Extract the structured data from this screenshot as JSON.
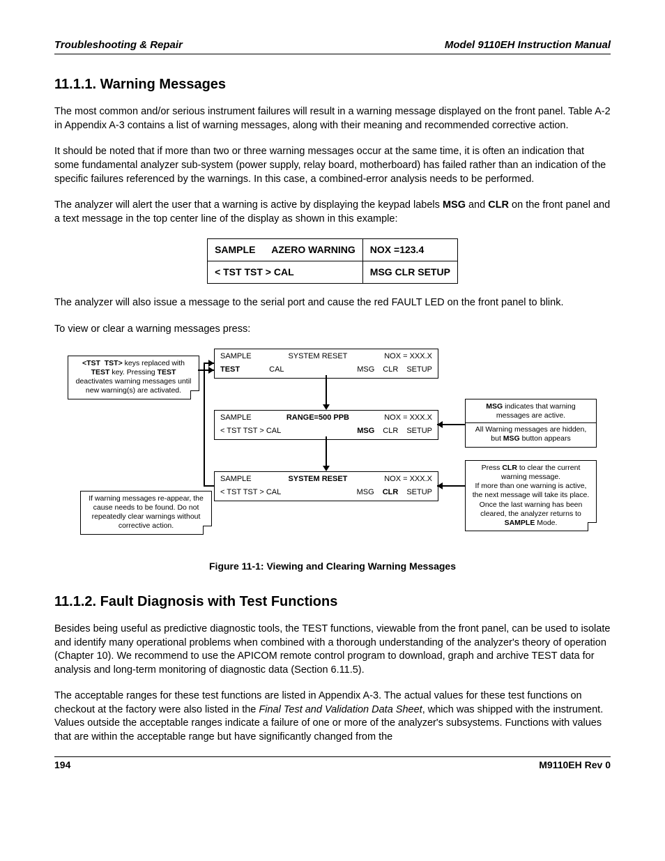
{
  "header": {
    "left": "Troubleshooting & Repair",
    "right": "Model 9110EH Instruction Manual"
  },
  "sec1": {
    "title": "11.1.1. Warning Messages",
    "p1": "The most common and/or serious instrument failures will result in a warning message displayed on the front panel. Table A-2 in Appendix A-3 contains a list of warning messages, along with their meaning and recommended corrective action.",
    "p2": "It should be noted that if more than two or three warning messages occur at the same time, it is often an indication that some fundamental analyzer sub-system (power supply, relay board, motherboard) has failed rather than an indication of the specific failures referenced by the warnings. In this case, a combined-error analysis needs to be performed.",
    "p3a": "The analyzer will alert the user that a warning is active by displaying the keypad labels ",
    "p3b": " and ",
    "p3c": " on the front panel and a text message in the top center line of the display as shown in this example:",
    "msg": "MSG",
    "clr": "CLR",
    "display": {
      "r1c1": "SAMPLE",
      "r1c2": "AZERO WARNING",
      "r1c3": "NOX =123.4",
      "r2c1": "< TST  TST >  CAL",
      "r2c2": "MSG  CLR   SETUP"
    },
    "p4": "The analyzer will also issue a message to the serial port and cause the red FAULT LED on the front panel to blink.",
    "p5": "To view or clear a warning messages press:"
  },
  "flow": {
    "note_left_top": "<TST  TST> keys replaced with TEST key. Pressing TEST deactivates warning messages until new warning(s) are activated.",
    "note_left_bot": "If warning messages re-appear, the cause needs to be found. Do not repeatedly clear warnings without corrective action.",
    "note_right_top": "MSG indicates that warning messages are active.\nAll Warning messages are hidden, but MSG button appears",
    "note_right_bot": "Press CLR to clear the current warning message.\nIf more than one warning is active, the next message will take its place.\nOnce the last warning has been cleared, the analyzer returns to SAMPLE Mode.",
    "p1": {
      "a": "SAMPLE",
      "b": "SYSTEM RESET",
      "c": "NOX = XXX.X",
      "d": "TEST",
      "e": "CAL",
      "f": "MSG",
      "g": "CLR",
      "h": "SETUP"
    },
    "p2": {
      "a": "SAMPLE",
      "b": "RANGE=500 PPB",
      "c": "NOX = XXX.X",
      "d": "< TST  TST >  CAL",
      "f": "MSG",
      "g": "CLR",
      "h": "SETUP"
    },
    "p3": {
      "a": "SAMPLE",
      "b": "SYSTEM RESET",
      "c": "NOX = XXX.X",
      "d": "< TST  TST >  CAL",
      "f": "MSG",
      "g": "CLR",
      "h": "SETUP"
    }
  },
  "figcap": "Figure 11-1: Viewing and Clearing Warning Messages",
  "sec2": {
    "title": "11.1.2. Fault Diagnosis with Test Functions",
    "p1": "Besides being useful as predictive diagnostic tools, the TEST functions, viewable from the front panel, can be used to isolate and identify many operational problems when combined with a thorough understanding of the analyzer's theory of operation (Chapter 10). We recommend to use the APICOM remote control program to download, graph and archive TEST data for analysis and long-term monitoring of diagnostic data (Section 6.11.5).",
    "p2a": "The acceptable ranges for these test functions are listed in Appendix A-3. The actual values for these test functions on checkout at the factory were also listed in the ",
    "p2i": "Final Test and Validation Data Sheet",
    "p2b": ", which was shipped with the instrument. Values outside the acceptable ranges indicate a failure of one or more of the analyzer's subsystems. Functions with values that are within the acceptable range but have significantly changed from the"
  },
  "footer": {
    "page": "194",
    "rev": "M9110EH Rev 0"
  }
}
